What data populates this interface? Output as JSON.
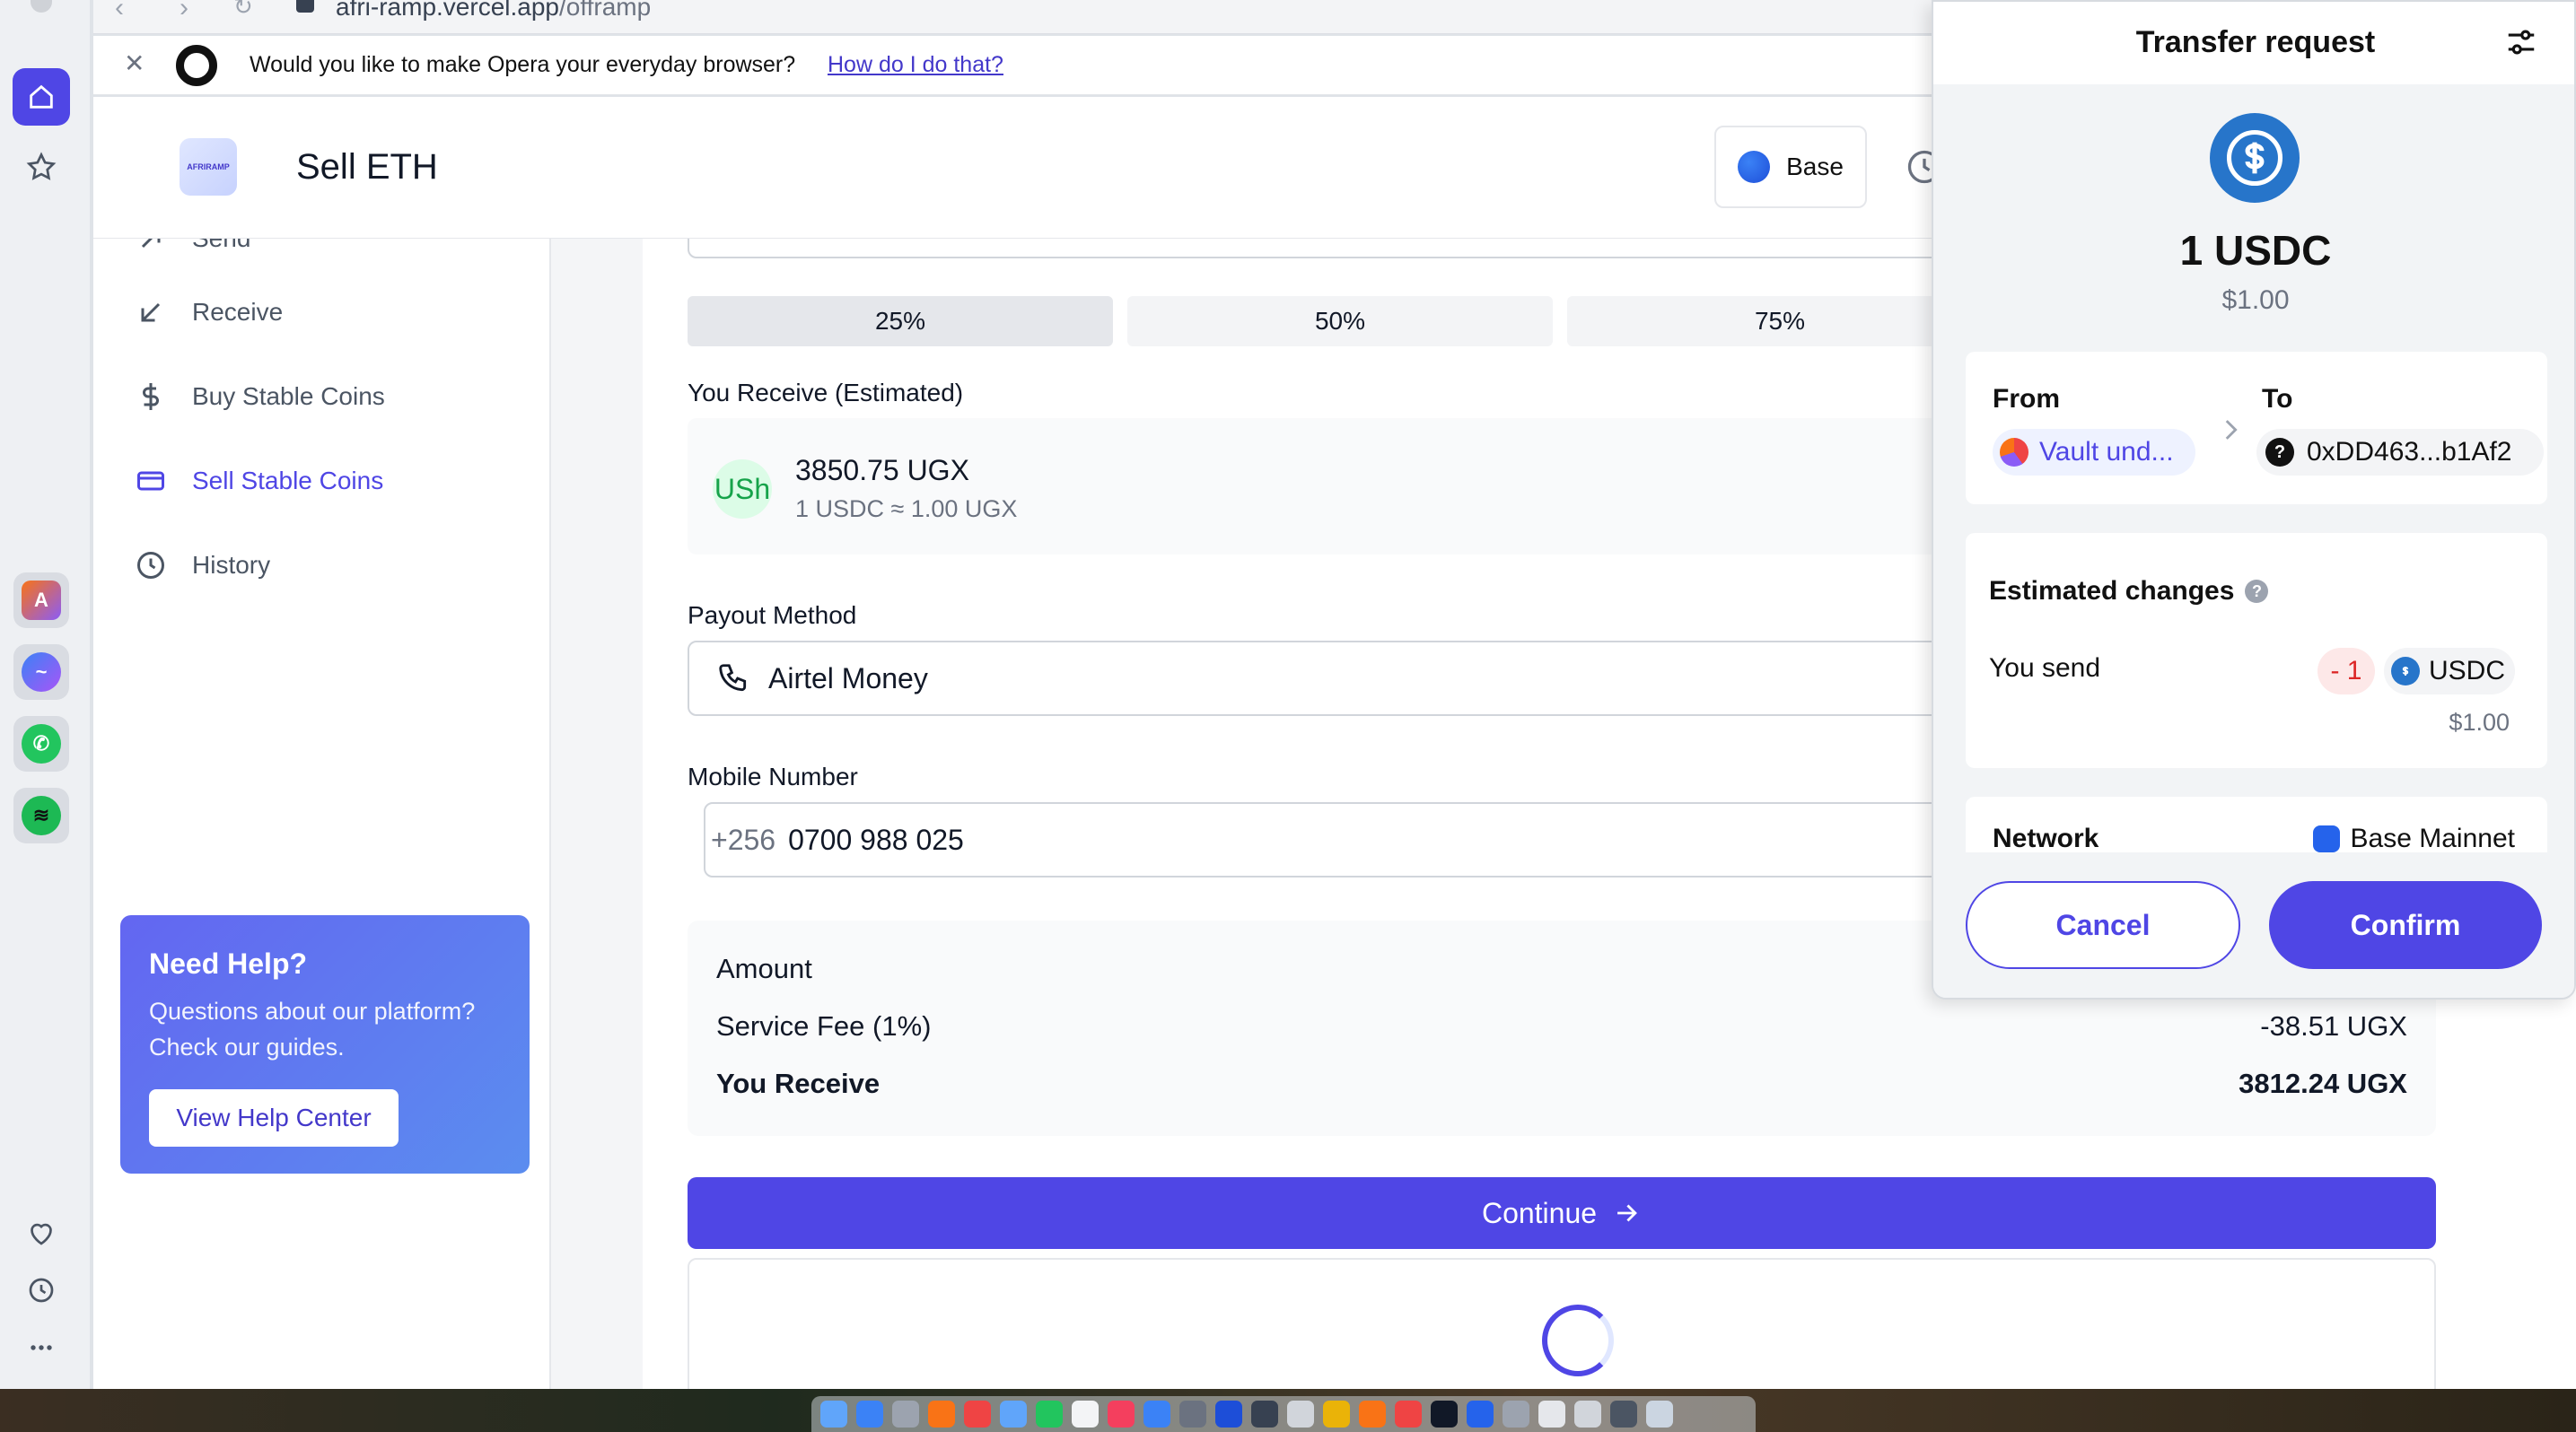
{
  "browser": {
    "url_host": "afri-ramp.vercel.app",
    "url_path": "/offramp",
    "banner_text": "Would you like to make Opera your everyday browser?",
    "banner_link": "How do I do that?"
  },
  "header": {
    "logo_text": "AFRIRAMP",
    "title": "Sell ETH",
    "network_label": "Base"
  },
  "sidebar": {
    "items": [
      {
        "label": "Send",
        "icon": "send-icon"
      },
      {
        "label": "Receive",
        "icon": "receive-icon"
      },
      {
        "label": "Buy Stable Coins",
        "icon": "dollar-icon"
      },
      {
        "label": "Sell Stable Coins",
        "icon": "card-icon",
        "active": true
      },
      {
        "label": "History",
        "icon": "clock-icon"
      }
    ],
    "help": {
      "title": "Need Help?",
      "text": "Questions about our platform? Check our guides.",
      "button": "View Help Center"
    }
  },
  "main": {
    "percent_buttons": [
      "25%",
      "50%",
      "75%"
    ],
    "receive_label": "You Receive (Estimated)",
    "currency_badge": "USh",
    "receive_amount": "3850.75 UGX",
    "receive_rate": "1 USDC ≈ 1.00 UGX",
    "payout_label": "Payout Method",
    "payout_value": "Airtel Money",
    "mobile_label": "Mobile Number",
    "mobile_prefix": "+256",
    "mobile_value": "0700 988 025",
    "summary": {
      "amount_label": "Amount",
      "fee_label": "Service Fee (1%)",
      "fee_value": "-38.51 UGX",
      "receive_label": "You Receive",
      "receive_value": "3812.24 UGX"
    },
    "continue_label": "Continue"
  },
  "wallet": {
    "title": "Transfer request",
    "token_amount": "1 USDC",
    "token_usd": "$1.00",
    "from_label": "From",
    "from_value": "Vault und...",
    "to_label": "To",
    "to_value": "0xDD463...b1Af2",
    "estimated_title": "Estimated changes",
    "you_send_label": "You send",
    "send_amount": "- 1",
    "send_token": "USDC",
    "send_usd": "$1.00",
    "network_label": "Network",
    "network_value": "Base Mainnet",
    "cancel_label": "Cancel",
    "confirm_label": "Confirm"
  },
  "colors": {
    "accent": "#4f46e5",
    "usdc": "#2775ca",
    "help_gradient_start": "#6366f1",
    "help_gradient_end": "#5b8def"
  }
}
